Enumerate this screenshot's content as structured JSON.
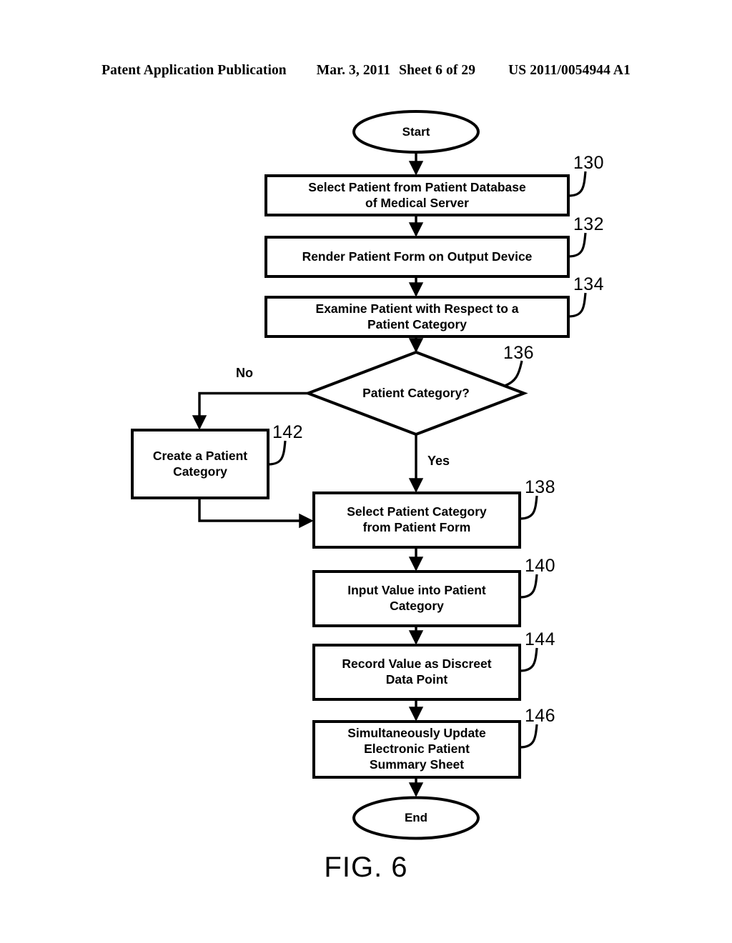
{
  "header": {
    "publication": "Patent Application Publication",
    "date": "Mar. 3, 2011",
    "sheet": "Sheet 6 of 29",
    "patent_number": "US 2011/0054944 A1"
  },
  "figure": {
    "caption": "FIG. 6"
  },
  "flowchart": {
    "type": "flowchart",
    "nodes": [
      {
        "id": "start",
        "shape": "terminator",
        "label": "Start",
        "ref": null
      },
      {
        "id": "n130",
        "shape": "process",
        "label": "Select Patient from Patient Database\nof Medical Server",
        "ref": "130"
      },
      {
        "id": "n132",
        "shape": "process",
        "label": "Render Patient Form on Output Device",
        "ref": "132"
      },
      {
        "id": "n134",
        "shape": "process",
        "label": "Examine Patient with Respect to a\nPatient Category",
        "ref": "134"
      },
      {
        "id": "n136",
        "shape": "decision",
        "label": "Patient Category?",
        "ref": "136"
      },
      {
        "id": "n142",
        "shape": "process",
        "label": "Create a Patient\nCategory",
        "ref": "142"
      },
      {
        "id": "n138",
        "shape": "process",
        "label": "Select Patient Category\nfrom Patient Form",
        "ref": "138"
      },
      {
        "id": "n140",
        "shape": "process",
        "label": "Input Value into Patient\nCategory",
        "ref": "140"
      },
      {
        "id": "n144",
        "shape": "process",
        "label": "Record Value as Discreet\nData Point",
        "ref": "144"
      },
      {
        "id": "n146",
        "shape": "process",
        "label": "Simultaneously Update\nElectronic Patient\nSummary Sheet",
        "ref": "146"
      },
      {
        "id": "end",
        "shape": "terminator",
        "label": "End",
        "ref": null
      }
    ],
    "edges": [
      {
        "from": "start",
        "to": "n130",
        "label": ""
      },
      {
        "from": "n130",
        "to": "n132",
        "label": ""
      },
      {
        "from": "n132",
        "to": "n134",
        "label": ""
      },
      {
        "from": "n134",
        "to": "n136",
        "label": ""
      },
      {
        "from": "n136",
        "to": "n142",
        "label": "No"
      },
      {
        "from": "n136",
        "to": "n138",
        "label": "Yes"
      },
      {
        "from": "n142",
        "to": "n138",
        "label": ""
      },
      {
        "from": "n138",
        "to": "n140",
        "label": ""
      },
      {
        "from": "n140",
        "to": "n144",
        "label": ""
      },
      {
        "from": "n144",
        "to": "n146",
        "label": ""
      },
      {
        "from": "n146",
        "to": "end",
        "label": ""
      }
    ],
    "branch_labels": {
      "no": "No",
      "yes": "Yes"
    },
    "refs": {
      "r130": "130",
      "r132": "132",
      "r134": "134",
      "r136": "136",
      "r138": "138",
      "r140": "140",
      "r142": "142",
      "r144": "144",
      "r146": "146"
    },
    "colors": {
      "stroke": "#000000",
      "fill": "#ffffff",
      "text": "#000000"
    }
  }
}
